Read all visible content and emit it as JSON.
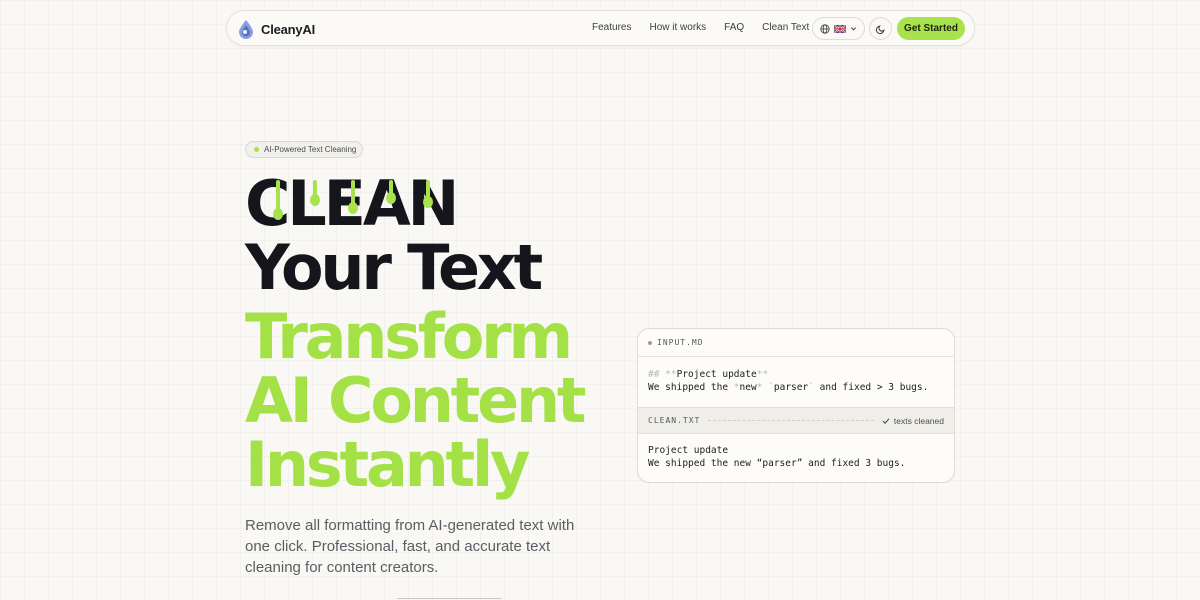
{
  "brand": {
    "name": "CleanyAI",
    "logo_icon": "droplet-icon"
  },
  "nav": {
    "links": [
      "Features",
      "How it works",
      "FAQ",
      "Clean Text"
    ],
    "language_icon": "globe-icon",
    "flag_icon": "uk-flag-icon",
    "theme_icon": "moon-icon",
    "cta_label": "Get Started"
  },
  "hero": {
    "badge": "AI-Powered Text Cleaning",
    "line1": "CLEAN",
    "line2": "Your Text",
    "line3": "Transform",
    "line4": "AI Content",
    "line5": "Instantly",
    "description": "Remove all formatting from AI-generated text with one click. Professional, fast, and accurate text cleaning for content creators."
  },
  "demo_card": {
    "input_label": "INPUT.MD",
    "input_line1_md1": "## **",
    "input_line1_text": "Project update",
    "input_line1_md2": "**",
    "input_line2_a": "We shipped the ",
    "input_line2_md1": "*",
    "input_line2_b": "new",
    "input_line2_md2": "*",
    "input_line2_md3": " `",
    "input_line2_c": "parser",
    "input_line2_md4": "`",
    "input_line2_d": " and fixed > 3 bugs.",
    "output_label": "CLEAN.TXT",
    "status": "texts cleaned",
    "status_icon": "check-icon",
    "output_line1": "Project update",
    "output_line2": "We shipped the new “parser” and fixed 3 bugs."
  },
  "colors": {
    "accent": "#a8e24c",
    "headline_dark": "#14161b",
    "headline_green": "#a4e146"
  }
}
